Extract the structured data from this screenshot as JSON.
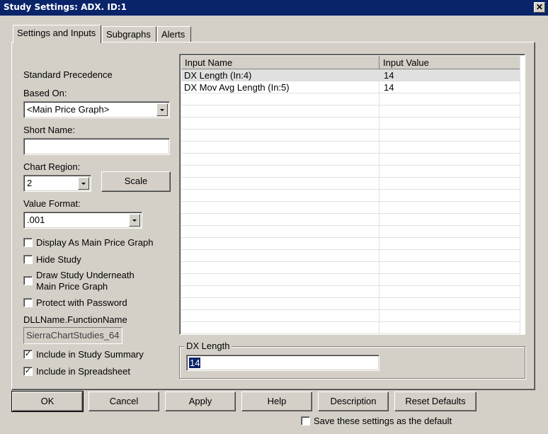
{
  "window": {
    "title": "Study Settings: ADX. ID:1",
    "close_glyph": "✕"
  },
  "tabs": [
    {
      "label": "Settings and Inputs",
      "active": true
    },
    {
      "label": "Subgraphs",
      "active": false
    },
    {
      "label": "Alerts",
      "active": false
    }
  ],
  "left": {
    "standard_precedence": "Standard Precedence",
    "based_on_label": "Based On:",
    "based_on_value": "<Main Price Graph>",
    "short_name_label": "Short Name:",
    "short_name_value": "",
    "chart_region_label": "Chart Region:",
    "chart_region_value": "2",
    "scale_button": "Scale",
    "value_format_label": "Value Format:",
    "value_format_value": ".001",
    "checkboxes": [
      {
        "label": "Display As Main Price Graph",
        "checked": false
      },
      {
        "label": "Hide Study",
        "checked": false
      },
      {
        "label": "Draw Study Underneath",
        "label2": "Main Price Graph",
        "checked": false
      },
      {
        "label": "Protect with Password",
        "checked": false
      }
    ],
    "dll_label": "DLLName.FunctionName",
    "dll_value": "SierraChartStudies_64",
    "checkboxes2": [
      {
        "label": "Include in Study Summary",
        "checked": true,
        "mark": "✓"
      },
      {
        "label": "Include in Spreadsheet",
        "checked": true,
        "mark": "✓"
      }
    ]
  },
  "grid": {
    "columns": [
      "Input Name",
      "Input Value"
    ],
    "rows": [
      {
        "name": "DX Length   (In:4)",
        "value": "14"
      },
      {
        "name": "DX Mov Avg Length   (In:5)",
        "value": "14"
      }
    ]
  },
  "selected_input": {
    "label": "DX Length",
    "value": "14"
  },
  "buttons": {
    "ok": "OK",
    "cancel": "Cancel",
    "apply": "Apply",
    "help": "Help",
    "description": "Description",
    "reset": "Reset Defaults"
  },
  "save_default": {
    "label": "Save these settings as the default",
    "checked": false
  },
  "colors": {
    "titlebar": "#0a246a",
    "face": "#d4d0c8",
    "selection": "#0a246a"
  }
}
